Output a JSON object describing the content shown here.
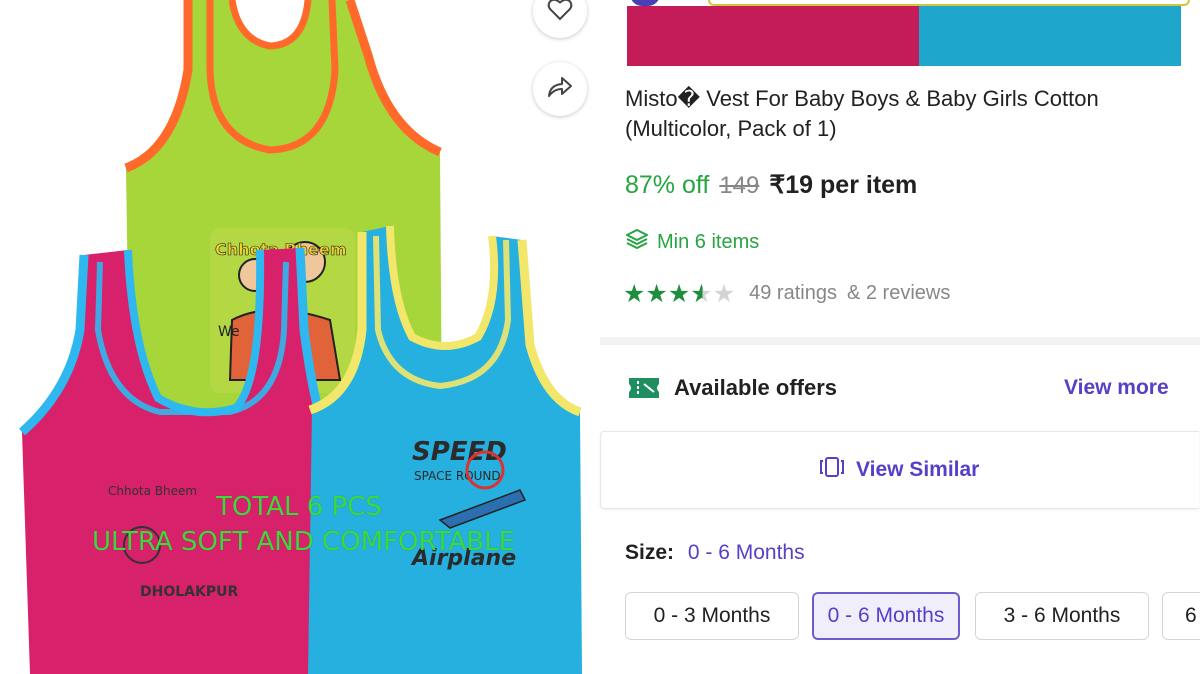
{
  "image": {
    "overlay_line_1": "TOTAL 6 PCS",
    "overlay_line_2": "ULTRA SOFT AND COMFORTABLE",
    "print_text_1": "SPEED",
    "print_text_2": "SPACE ROUND",
    "print_text_3": "Airplane",
    "print_text_4": "Chhota Bheem",
    "print_text_5": "DHOLAKPUR",
    "print_text_6": "We",
    "garment_colors": [
      "#a6d63a",
      "#d7216a",
      "#25b0e0"
    ]
  },
  "actions": {
    "wishlist_icon": "heart-icon",
    "share_icon": "share-arrow-icon"
  },
  "product": {
    "title": "Misto� Vest For Baby Boys & Baby Girls Cotton (Multicolor, Pack of 1)",
    "discount": "87% off",
    "mrp": "149",
    "price": "₹19 per item",
    "min_items": "Min 6 items",
    "rating_value": 3.5,
    "ratings_text": "49 ratings",
    "reviews_text": "& 2 reviews"
  },
  "offers": {
    "label": "Available offers",
    "view_more": "View more"
  },
  "similar": {
    "label": "View Similar"
  },
  "size": {
    "label": "Size:",
    "selected": "0 - 6 Months",
    "options": [
      "0 - 3 Months",
      "0 - 6 Months",
      "3 - 6 Months",
      "6"
    ]
  },
  "colors": {
    "accent": "#5640c8",
    "green": "#26a541",
    "swatch_1": "#c41c58",
    "swatch_2": "#1fa6cc"
  }
}
